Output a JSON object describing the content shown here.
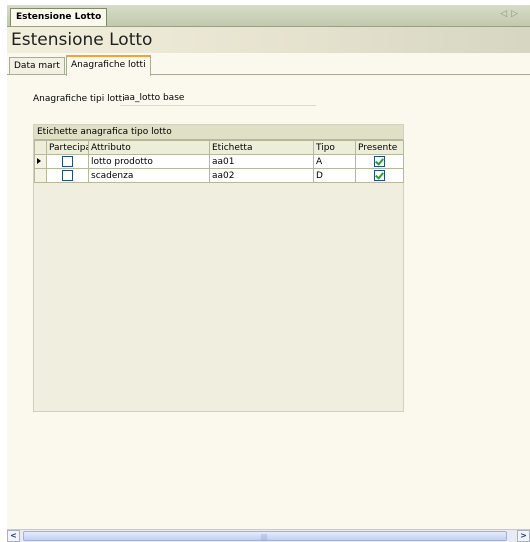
{
  "doc_tab": {
    "label": "Estensione Lotto"
  },
  "header": {
    "title": "Estensione Lotto"
  },
  "tab_nav": {
    "prev": "◁",
    "next": "▷"
  },
  "tabs": [
    {
      "label": "Data mart"
    },
    {
      "label": "Anagrafiche lotti",
      "active": true
    }
  ],
  "form": {
    "lotti_label": "Anagrafiche tipi lotti",
    "lotti_value": "aa_lotto base"
  },
  "grid": {
    "caption": "Etichette anagrafica tipo lotto",
    "columns": [
      "Partecipa",
      "Attributo",
      "Etichetta",
      "Tipo",
      "Presente"
    ],
    "rows": [
      {
        "partecipa": false,
        "attributo": "lotto prodotto",
        "etichetta": "aa01",
        "tipo": "A",
        "presente": true,
        "current": true
      },
      {
        "partecipa": false,
        "attributo": "scadenza",
        "etichetta": "aa02",
        "tipo": "D",
        "presente": true,
        "current": false
      }
    ]
  },
  "scrollbar": {
    "left_arrow": "<",
    "right_arrow": ">",
    "grip": "|||"
  },
  "colors": {
    "accent_tab": "#f0a43a",
    "background": "#fbf9ee",
    "check": "#2aa02a"
  }
}
